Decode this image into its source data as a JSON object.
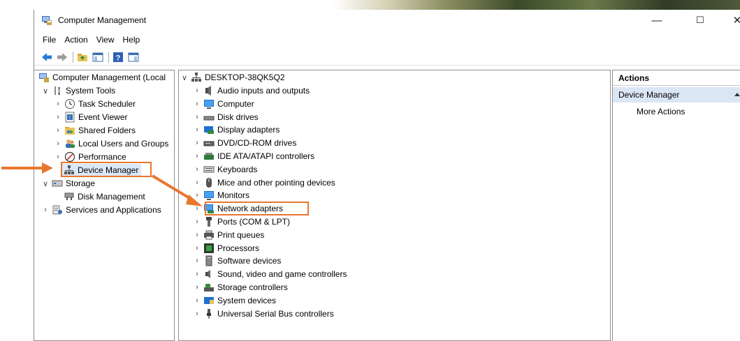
{
  "window": {
    "title": "Computer Management",
    "controls": {
      "minimize": "—",
      "maximize": "☐",
      "close": "✕"
    }
  },
  "menu": [
    "File",
    "Action",
    "View",
    "Help"
  ],
  "toolbar": {
    "icons": [
      "back-arrow-icon",
      "forward-arrow-icon",
      "up-folder-icon",
      "show-hide-tree-icon",
      "help-icon",
      "show-hide-action-pane-icon"
    ]
  },
  "left_tree": [
    {
      "label": "Computer Management (Local",
      "icon": "computer-management-icon",
      "chevron": "",
      "level": 0
    },
    {
      "label": "System Tools",
      "icon": "system-tools-icon",
      "chevron": "∨",
      "level": 1
    },
    {
      "label": "Task Scheduler",
      "icon": "task-scheduler-icon",
      "chevron": "›",
      "level": 2
    },
    {
      "label": "Event Viewer",
      "icon": "event-viewer-icon",
      "chevron": "›",
      "level": 2
    },
    {
      "label": "Shared Folders",
      "icon": "shared-folders-icon",
      "chevron": "›",
      "level": 2
    },
    {
      "label": "Local Users and Groups",
      "icon": "users-icon",
      "chevron": "›",
      "level": 2
    },
    {
      "label": "Performance",
      "icon": "performance-icon",
      "chevron": "›",
      "level": 2
    },
    {
      "label": "Device Manager",
      "icon": "device-manager-icon",
      "chevron": "",
      "level": 2,
      "selected": true
    },
    {
      "label": "Storage",
      "icon": "storage-icon",
      "chevron": "∨",
      "level": 1
    },
    {
      "label": "Disk Management",
      "icon": "disk-management-icon",
      "chevron": "",
      "level": 2
    },
    {
      "label": "Services and Applications",
      "icon": "services-icon",
      "chevron": "›",
      "level": 1
    }
  ],
  "device_tree": {
    "root": {
      "label": "DESKTOP-38QK5Q2",
      "icon": "desktop-computer-icon",
      "chevron": "∨"
    },
    "categories": [
      {
        "label": "Audio inputs and outputs",
        "icon": "speaker-icon"
      },
      {
        "label": "Computer",
        "icon": "monitor-icon"
      },
      {
        "label": "Disk drives",
        "icon": "disk-drive-icon"
      },
      {
        "label": "Display adapters",
        "icon": "display-adapter-icon"
      },
      {
        "label": "DVD/CD-ROM drives",
        "icon": "dvd-drive-icon"
      },
      {
        "label": "IDE ATA/ATAPI controllers",
        "icon": "ide-controller-icon"
      },
      {
        "label": "Keyboards",
        "icon": "keyboard-icon"
      },
      {
        "label": "Mice and other pointing devices",
        "icon": "mouse-icon"
      },
      {
        "label": "Monitors",
        "icon": "monitor-icon"
      },
      {
        "label": "Network adapters",
        "icon": "network-adapter-icon"
      },
      {
        "label": "Ports (COM & LPT)",
        "icon": "port-icon"
      },
      {
        "label": "Print queues",
        "icon": "printer-icon"
      },
      {
        "label": "Processors",
        "icon": "processor-icon"
      },
      {
        "label": "Software devices",
        "icon": "software-device-icon"
      },
      {
        "label": "Sound, video and game controllers",
        "icon": "sound-icon"
      },
      {
        "label": "Storage controllers",
        "icon": "storage-controller-icon"
      },
      {
        "label": "System devices",
        "icon": "system-devices-icon"
      },
      {
        "label": "Universal Serial Bus controllers",
        "icon": "usb-icon"
      }
    ]
  },
  "actions": {
    "header": "Actions",
    "section": "Device Manager",
    "more": "More Actions"
  },
  "colors": {
    "annotation_orange": "#e8772e",
    "selection_blue": "#dbe8f7",
    "actions_section_bg": "#dbe6f5"
  }
}
